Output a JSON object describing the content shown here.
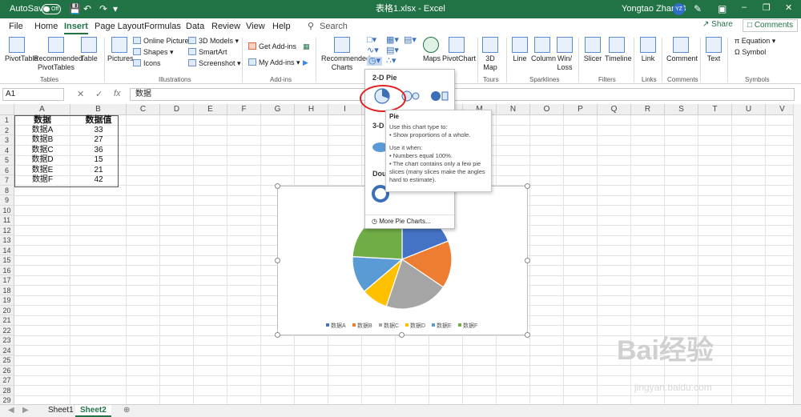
{
  "titlebar": {
    "autosave_label": "AutoSave",
    "autosave_state": "Off",
    "document_title": "表格1.xlsx - Excel",
    "search_label": "Search",
    "user_name": "Yongtao Zhang3",
    "user_initials": "YZ"
  },
  "tabs": [
    "File",
    "Home",
    "Insert",
    "Page Layout",
    "Formulas",
    "Data",
    "Review",
    "View",
    "Help"
  ],
  "share_label": "Share",
  "comments_label": "Comments",
  "ribbon": {
    "tables": {
      "pivot_table": "PivotTable",
      "recommended_pivot": "Recommended PivotTables",
      "table": "Table",
      "group": "Tables"
    },
    "illustrations": {
      "pictures": "Pictures",
      "online_pictures": "Online Pictures",
      "shapes": "Shapes",
      "icons": "Icons",
      "models_3d": "3D Models",
      "smartart": "SmartArt",
      "screenshot": "Screenshot",
      "group": "Illustrations"
    },
    "addins": {
      "get_addins": "Get Add-ins",
      "my_addins": "My Add-ins",
      "group": "Add-ins"
    },
    "charts": {
      "recommended": "Recommended Charts",
      "maps": "Maps",
      "pivot_chart": "PivotChart"
    },
    "tours": {
      "map3d": "3D Map",
      "group": "Tours"
    },
    "sparklines": {
      "line": "Line",
      "column": "Column",
      "winloss": "Win/ Loss",
      "group": "Sparklines"
    },
    "filters": {
      "slicer": "Slicer",
      "timeline": "Timeline",
      "group": "Filters"
    },
    "links": {
      "link": "Link",
      "group": "Links"
    },
    "comments": {
      "comment": "Comment",
      "group": "Comments"
    },
    "text": {
      "text": "Text"
    },
    "symbols": {
      "equation": "Equation",
      "symbol": "Symbol",
      "group": "Symbols"
    }
  },
  "formula_bar": {
    "name_box": "A1",
    "content": "数据"
  },
  "columns": [
    "A",
    "B",
    "C",
    "D",
    "E",
    "F",
    "G",
    "H",
    "I",
    "J",
    "K",
    "L",
    "M",
    "N",
    "O",
    "P",
    "Q",
    "R",
    "S",
    "T",
    "U",
    "V"
  ],
  "rows": [
    "1",
    "2",
    "3",
    "4",
    "5",
    "6",
    "7",
    "8",
    "9",
    "10",
    "11",
    "12",
    "13",
    "14",
    "15",
    "16",
    "17",
    "18",
    "19",
    "20",
    "21",
    "22",
    "23",
    "24",
    "25",
    "26",
    "27",
    "28",
    "29"
  ],
  "table": {
    "headers": [
      "数据",
      "数据值"
    ],
    "rows": [
      [
        "数据A",
        "33"
      ],
      [
        "数据B",
        "27"
      ],
      [
        "数据C",
        "36"
      ],
      [
        "数据D",
        "15"
      ],
      [
        "数据E",
        "21"
      ],
      [
        "数据F",
        "42"
      ]
    ]
  },
  "chart_data": {
    "type": "pie",
    "categories": [
      "数据A",
      "数据B",
      "数据C",
      "数据D",
      "数据E",
      "数据F"
    ],
    "values": [
      33,
      27,
      36,
      15,
      21,
      42
    ],
    "colors": [
      "#4472c4",
      "#ed7d31",
      "#a5a5a5",
      "#ffc000",
      "#5b9bd5",
      "#70ad47"
    ],
    "legend": "bottom"
  },
  "dropdown": {
    "section_2d": "2-D Pie",
    "section_3d": "3-D Pie",
    "section_doughnut": "Doughnut",
    "more": "More Pie Charts..."
  },
  "tooltip": {
    "title": "Pie",
    "lines": [
      "Use this chart type to:",
      "• Show proportions of a whole.",
      "",
      "Use it when:",
      "• Numbers equal 100%.",
      "• The chart contains only a few pie",
      "slices (many slices make the angles",
      "hard to estimate)."
    ]
  },
  "sheets": [
    "Sheet1",
    "Sheet2"
  ],
  "active_sheet": "Sheet2",
  "watermark": {
    "brand": "Bai经验",
    "url": "jingyan.baidu.com"
  }
}
